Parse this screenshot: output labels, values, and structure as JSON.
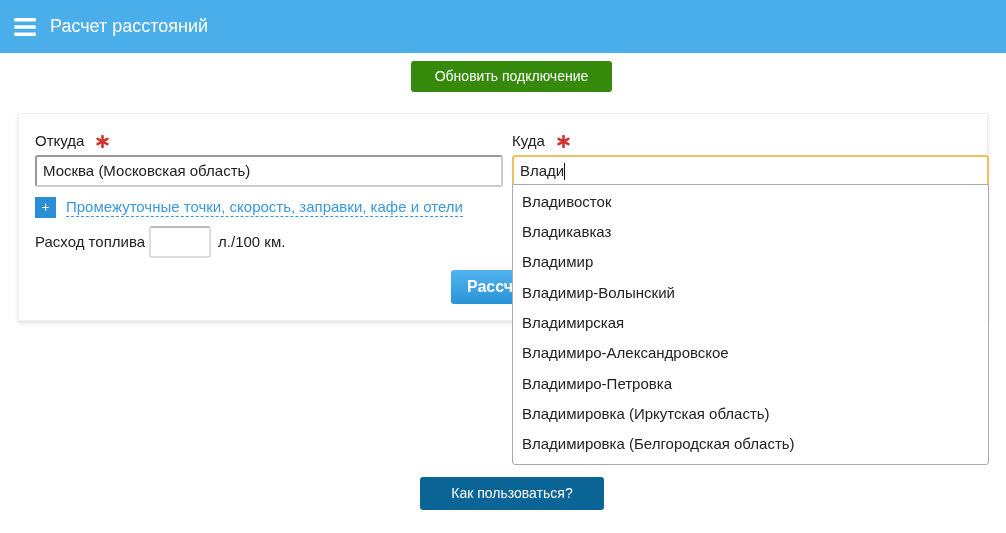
{
  "header": {
    "title": "Расчет расстояний"
  },
  "refresh_button": "Обновить подключение",
  "form": {
    "from": {
      "label": "Откуда",
      "required": true,
      "value": "Москва (Московская область)"
    },
    "to": {
      "label": "Куда",
      "required": true,
      "value": "Влади",
      "focused": true
    },
    "options_toggle": {
      "icon": "+",
      "label": "Промежуточные точки, скорость, заправки, кафе и отели"
    },
    "fuel": {
      "label": "Расход топлива",
      "unit": "л./100 км."
    },
    "calculate_button": "Рассч"
  },
  "suggestions": [
    "Владивосток",
    "Владикавказ",
    "Владимир",
    "Владимир-Волынский",
    "Владимирская",
    "Владимиро-Александровское",
    "Владимиро-Петровка",
    "Владимировка (Иркутская область)",
    "Владимировка (Белгородская область)"
  ],
  "help_button": "Как пользоваться?"
}
